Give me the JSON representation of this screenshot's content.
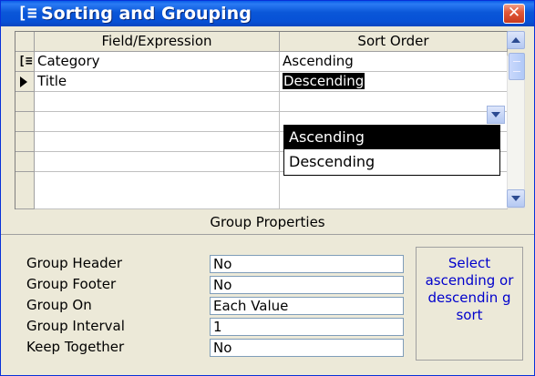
{
  "window": {
    "title": "Sorting and Grouping",
    "title_icon": "[≡",
    "close_label": "✕"
  },
  "grid": {
    "columns": [
      "Field/Expression",
      "Sort Order"
    ],
    "rows": [
      {
        "field": "Category",
        "sort": "Ascending",
        "indicator": "group-icon"
      },
      {
        "field": "Title",
        "sort": "Descending",
        "indicator": "current-row-arrow"
      },
      {
        "field": "",
        "sort": "",
        "indicator": ""
      },
      {
        "field": "",
        "sort": "",
        "indicator": ""
      },
      {
        "field": "",
        "sort": "",
        "indicator": ""
      },
      {
        "field": "",
        "sort": "",
        "indicator": ""
      }
    ],
    "dropdown_options": [
      "Ascending",
      "Descending"
    ],
    "dropdown_highlighted": "Ascending"
  },
  "group_properties": {
    "title": "Group Properties",
    "props": [
      {
        "label": "Group Header",
        "value": "No"
      },
      {
        "label": "Group Footer",
        "value": "No"
      },
      {
        "label": "Group On",
        "value": "Each Value"
      },
      {
        "label": "Group Interval",
        "value": "1"
      },
      {
        "label": "Keep Together",
        "value": "No"
      }
    ],
    "help_text": "Select ascending or descendin g sort"
  },
  "colors": {
    "titlebar": "#0a57d8",
    "help_text": "#0000cc",
    "selection": "#000000"
  }
}
